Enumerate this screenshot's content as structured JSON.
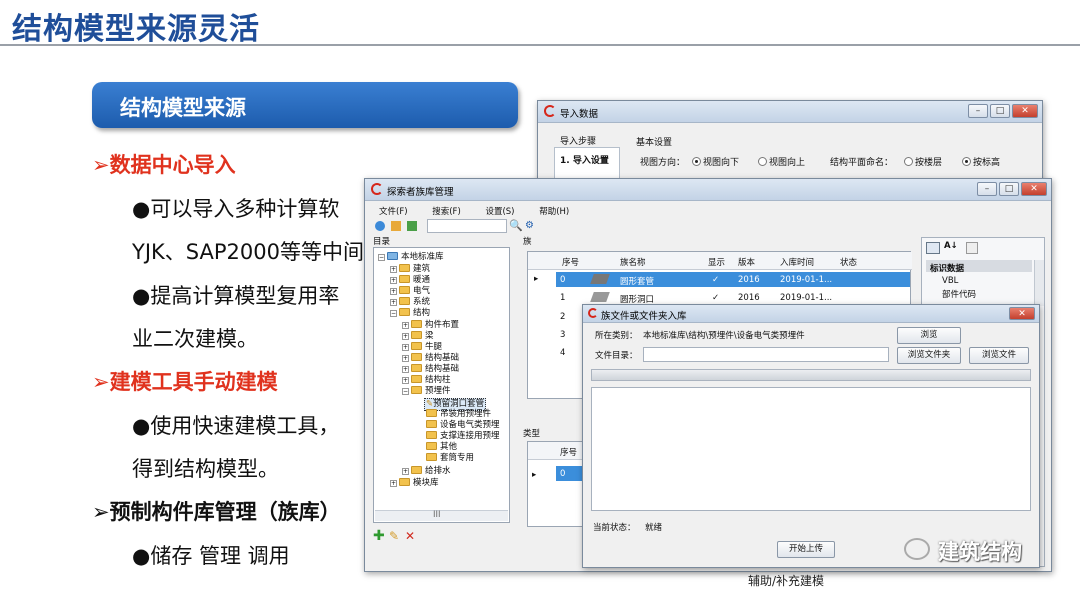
{
  "slide": {
    "title": "结构模型来源灵活",
    "section": "结构模型来源",
    "bullets": [
      "➢数据中心导入",
      "●可以导入多种计算软",
      "YJK、SAP2000等等中间",
      "●提高计算模型复用率",
      "业二次建模。",
      "➢建模工具手动建模",
      "●使用快速建模工具，",
      "得到结构模型。",
      "➢预制构件库管理（族库）",
      "●储存 管理 调用"
    ],
    "watermark": "建筑结构",
    "bottom_caption": "辅助/补充建模"
  },
  "import_window": {
    "title": "导入数据",
    "steps_label": "导入步骤",
    "step1": "1. 导入设置",
    "basic_settings": "基本设置",
    "view_direction_label": "视图方向：",
    "radio_view_down": "视图向下",
    "radio_view_up": "视图向上",
    "plane_name_label": "结构平面命名：",
    "radio_by_floor": "按楼层",
    "radio_by_elev": "按标高"
  },
  "lib_window": {
    "title": "探索者族库管理",
    "menu": [
      "文件(F)",
      "搜索(F)",
      "设置(S)",
      "帮助(H)"
    ],
    "catalog_label": "目录",
    "family_label": "族",
    "type_label": "类型",
    "tree": [
      "本地标准库",
      "建筑",
      "暖通",
      "电气",
      "系统",
      "结构",
      "构件布置",
      "梁",
      "牛腿",
      "结构基础",
      "结构基础",
      "结构柱",
      "预埋件",
      "预留洞口套管",
      "吊装用预埋件",
      "设备电气类预埋",
      "支撑连接用预埋",
      "其他",
      "套筒专用",
      "给排水",
      "模块库"
    ],
    "columns": [
      "序号",
      "族名称",
      "显示",
      "版本",
      "入库时间",
      "状态"
    ],
    "rows": [
      {
        "no": "0",
        "name": "圆形套管",
        "show": "✓",
        "ver": "2016",
        "date": "2019-01-1..."
      },
      {
        "no": "1",
        "name": "圆形洞口",
        "show": "✓",
        "ver": "2016",
        "date": "2019-01-1..."
      },
      {
        "no": "2"
      },
      {
        "no": "3"
      },
      {
        "no": "4"
      }
    ],
    "type_columns": [
      "序号"
    ],
    "type_rows": [
      "0"
    ],
    "props_heading": "标识数据",
    "props": [
      "VBL",
      "部件代码"
    ],
    "hscroll": "III"
  },
  "upload_dialog": {
    "title": "族文件或文件夹入库",
    "category_label": "所在类别：",
    "category_value": "本地标准库\\结构\\预埋件\\设备电气类预埋件",
    "dir_label": "文件目录：",
    "dir_value": "",
    "browse_btn": "浏览",
    "browse_folder_btn": "浏览文件夹",
    "browse_file_btn": "浏览文件",
    "status_label": "当前状态：",
    "status_value": "就绪",
    "upload_btn": "开始上传"
  }
}
